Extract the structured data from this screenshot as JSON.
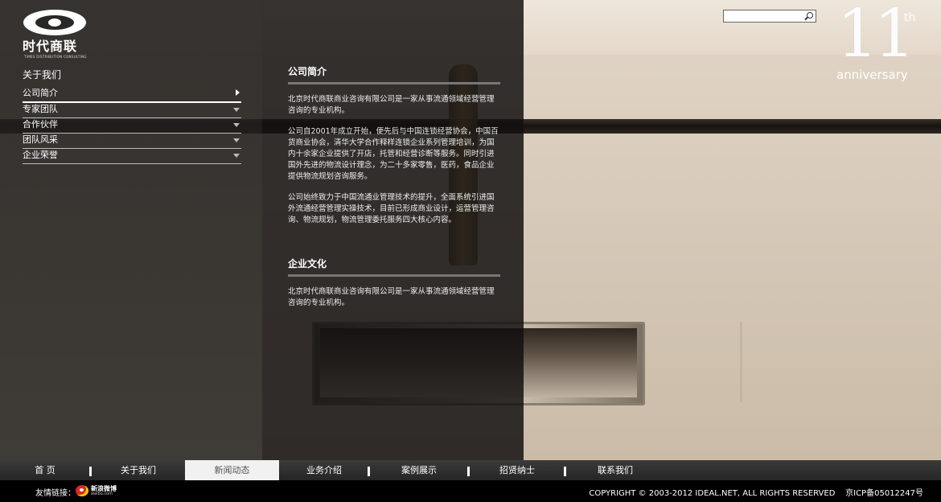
{
  "logo": {
    "brand": "时代商联",
    "sub": "TIMES DISTRIBUTION CONSULTING"
  },
  "sidebar": {
    "title": "关于我们",
    "items": [
      {
        "label": "公司简介",
        "active": true
      },
      {
        "label": "专家团队"
      },
      {
        "label": "合作伙伴"
      },
      {
        "label": "团队风采"
      },
      {
        "label": "企业荣誉"
      }
    ]
  },
  "content": {
    "section1": {
      "title": "公司简介",
      "paragraphs": [
        "北京时代商联商业咨询有限公司是一家从事流通领域经营管理咨询的专业机构。",
        "公司自2001年成立开始，便先后与中国连锁经营协会，中国百货商业协会，清华大学合作释样连锁企业系列管理培训，为国内十余家企业提供了开店，托管和经营诊断等服务。同时引进国外先进的物流设计理念，为二十多家零售，医药，食品企业提供物流规划咨询服务。",
        "公司始终致力于中国流通业管理技术的提升，全面系统引进国外流通经营管理实操技术，目前已形成商业设计，运营管理咨询、物流规划，物流管理委托服务四大核心内容。"
      ]
    },
    "section2": {
      "title": "企业文化",
      "paragraphs": [
        "北京时代商联商业咨询有限公司是一家从事流通领域经营管理咨询的专业机构。"
      ]
    }
  },
  "search": {
    "placeholder": ""
  },
  "anniversary": {
    "number": "11",
    "suffix": "th",
    "word": "anniversary"
  },
  "bottom_nav": {
    "items": [
      {
        "label": "首 页"
      },
      {
        "label": "关于我们"
      },
      {
        "label": "新闻动态",
        "active": true
      },
      {
        "label": "业务介绍"
      },
      {
        "label": "案例展示"
      },
      {
        "label": "招贤纳士"
      },
      {
        "label": "联系我们"
      }
    ]
  },
  "footer": {
    "links_label": "友情链接：",
    "weibo_name": "新浪微博",
    "weibo_domain": "weibo.com",
    "copyright": "COPYRIGHT © 2003-2012 IDEAL.NET, ALL RIGHTS RESERVED    京ICP备05012247号"
  },
  "colors": {
    "panel_dark": "#121110",
    "bottom_nav": "#333333",
    "active_tab": "#f1f1f1"
  }
}
